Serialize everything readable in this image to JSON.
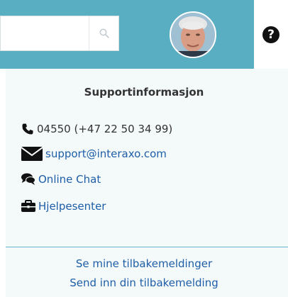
{
  "header": {
    "search": {
      "placeholder": "",
      "icon": "search-icon"
    },
    "avatar": {
      "icon": "user-avatar"
    },
    "help": {
      "icon": "question-circle-icon",
      "glyph": "?"
    },
    "bar_color": "#5aaec2"
  },
  "support": {
    "title": "Supportinformasjon",
    "phone": "04550 (+47 22 50 34 99)",
    "email": "support@interaxo.com",
    "chat": "Online Chat",
    "help_center": "Hjelpesenter"
  },
  "feedback": {
    "mine": "Se mine tilbakemeldinger",
    "send": "Send inn din tilbakemelding"
  },
  "colors": {
    "link": "#1e5ea8",
    "panel_bg": "#f4f9fa",
    "divider": "#6bb6cc"
  }
}
